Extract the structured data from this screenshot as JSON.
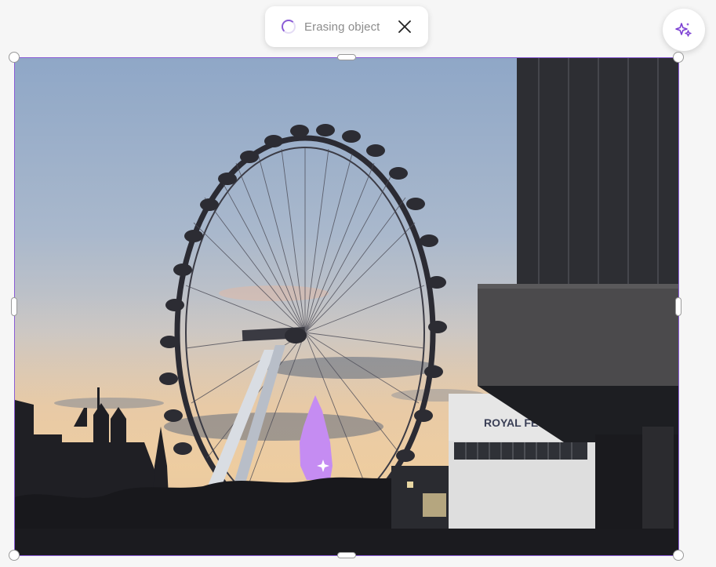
{
  "status": {
    "text": "Erasing object",
    "close_icon": "close-icon",
    "spinner_icon": "loading-spinner-icon"
  },
  "ai_button": {
    "icon": "sparkles-icon"
  },
  "photo": {
    "building_sign": "ROYAL FE",
    "description_icon": "erase-selection-mask"
  },
  "colors": {
    "accent": "#8a5cd6",
    "mask": "#c58cf2"
  }
}
